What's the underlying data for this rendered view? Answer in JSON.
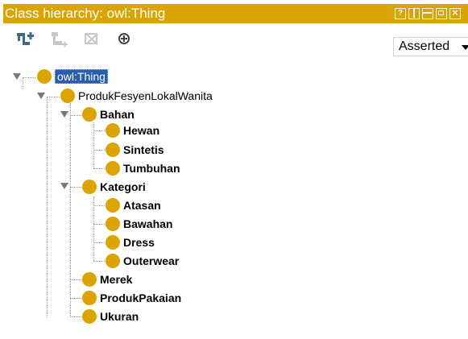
{
  "panel": {
    "title": "Class hierarchy: owl:Thing",
    "window_controls": [
      "help-icon",
      "split-vertical-icon",
      "split-horizontal-icon",
      "maximize-icon",
      "close-icon"
    ]
  },
  "toolbar": {
    "buttons": [
      {
        "name": "add-subclass",
        "icon": "add-subclass-icon",
        "enabled": true
      },
      {
        "name": "add-sibling",
        "icon": "add-sibling-icon",
        "enabled": false
      },
      {
        "name": "delete-class",
        "icon": "delete-class-icon",
        "enabled": false
      },
      {
        "name": "find",
        "icon": "crosshair-icon",
        "enabled": true
      }
    ],
    "view_select": "Asserted"
  },
  "colors": {
    "title_bar": "#d9a300",
    "class_dot": "#dba400",
    "selection": "#2a5db0"
  },
  "tree": {
    "root": "owl:Thing",
    "level1": "ProdukFesyenLokalWanita",
    "bahan": {
      "label": "Bahan",
      "children": [
        "Hewan",
        "Sintetis",
        "Tumbuhan"
      ]
    },
    "kategori": {
      "label": "Kategori",
      "children": [
        "Atasan",
        "Bawahan",
        "Dress",
        "Outerwear"
      ]
    },
    "others": [
      "Merek",
      "ProdukPakaian",
      "Ukuran"
    ]
  }
}
